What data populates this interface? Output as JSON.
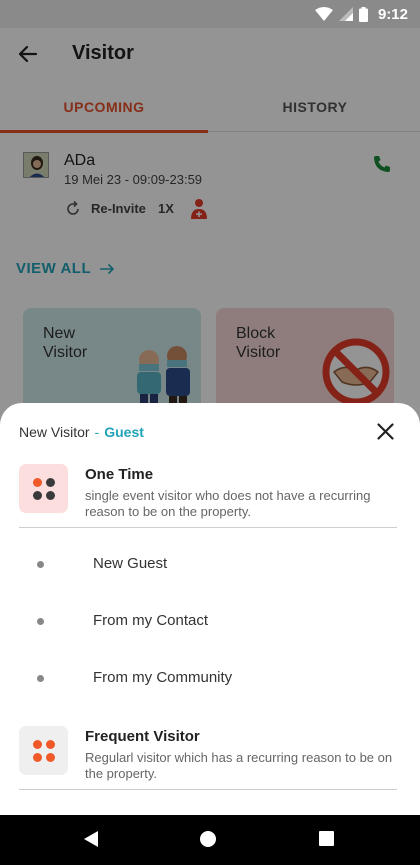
{
  "status_bar": {
    "time": "9:12"
  },
  "header": {
    "title": "Visitor"
  },
  "tabs": [
    {
      "label": "UPCOMING",
      "active": true
    },
    {
      "label": "HISTORY",
      "active": false
    }
  ],
  "visit": {
    "name": "ADa",
    "time": "19 Mei 23 - 09:09-23:59",
    "reinvite_label": "Re-Invite",
    "count": "1X"
  },
  "view_all": {
    "label": "VIEW ALL"
  },
  "cards": {
    "new_visitor": "New\nVisitor",
    "block_visitor": "Block\nVisitor"
  },
  "sheet": {
    "title": "New Visitor",
    "separator": "-",
    "type": "Guest",
    "options": [
      {
        "title": "One Time",
        "description": "single event visitor who does not have a recurring reason to be on the property.",
        "sub_items": [
          "New Guest",
          "From my Contact",
          "From my Community"
        ]
      },
      {
        "title": "Frequent Visitor",
        "description": "Regularl visitor which has a recurring reason to be on the property."
      }
    ]
  },
  "colors": {
    "accent": "#e8502a",
    "link": "#22a3b8",
    "phone": "#1e8a3c",
    "dot_dark": "#3a3a3a",
    "dot_orange": "#f05a28"
  },
  "icons": {
    "back": "arrow-left-icon",
    "phone": "phone-icon",
    "reinvite": "refresh-icon",
    "add_person": "add-person-icon",
    "close": "close-icon",
    "view_all_arrow": "arrow-right-icon"
  }
}
